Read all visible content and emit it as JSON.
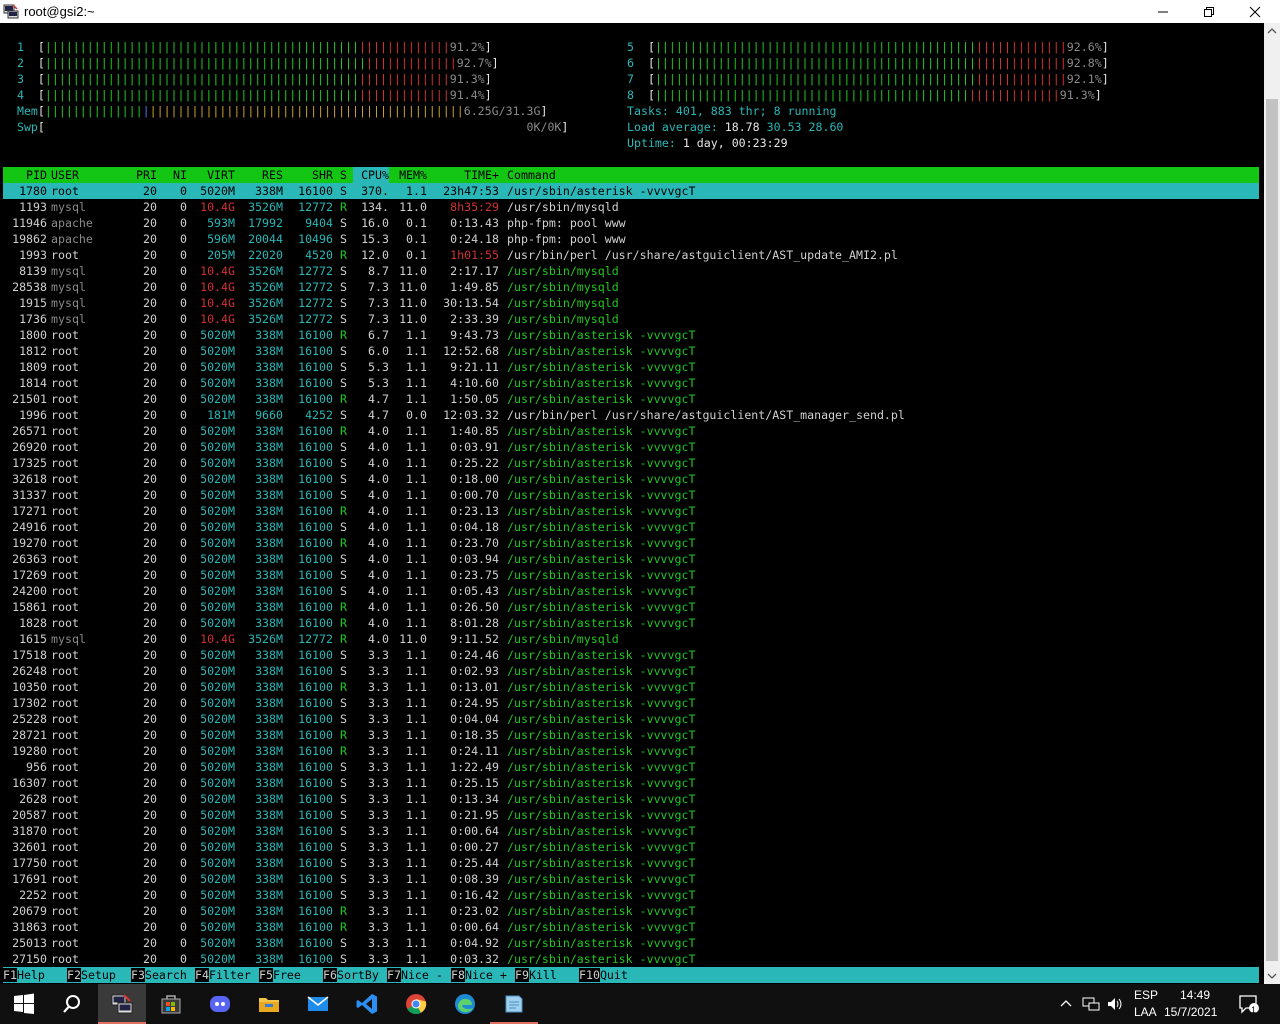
{
  "window": {
    "title": "root@gsi2:~"
  },
  "meters": {
    "cpus": [
      {
        "id": "1",
        "pct": "91.2%"
      },
      {
        "id": "2",
        "pct": "92.7%"
      },
      {
        "id": "3",
        "pct": "91.3%"
      },
      {
        "id": "4",
        "pct": "91.4%"
      },
      {
        "id": "5",
        "pct": "92.6%"
      },
      {
        "id": "6",
        "pct": "92.8%"
      },
      {
        "id": "7",
        "pct": "92.1%"
      },
      {
        "id": "8",
        "pct": "91.3%"
      }
    ],
    "mem": {
      "label": "Mem",
      "value": "6.25G/31.3G"
    },
    "swp": {
      "label": "Swp",
      "value": "0K/0K"
    },
    "tasks": {
      "label": "Tasks:",
      "count": "401,",
      "thr": "883",
      "thr_label": "thr;",
      "running": "8",
      "running_label": "running"
    },
    "load": {
      "label": "Load average:",
      "l1": "18.78",
      "l5": "30.53",
      "l15": "28.60"
    },
    "uptime": {
      "label": "Uptime:",
      "value": "1 day, 00:23:29"
    }
  },
  "columns": {
    "pid": "PID",
    "user": "USER",
    "pri": "PRI",
    "ni": "NI",
    "virt": "VIRT",
    "res": "RES",
    "shr": "SHR",
    "s": "S",
    "cpu": "CPU%",
    "mem": "MEM%",
    "time": "TIME+",
    "cmd": "Command"
  },
  "processes": [
    {
      "pid": "1780",
      "user": "root",
      "pri": "20",
      "ni": "0",
      "virt": "5020M",
      "res": "338M",
      "shr": "16100",
      "s": "S",
      "cpu": "370.",
      "mem": "1.1",
      "time": "23h47:53",
      "cmd": "/usr/sbin/asterisk -vvvvgcT"
    },
    {
      "pid": "1193",
      "user": "mysql",
      "pri": "20",
      "ni": "0",
      "virt": "10.4G",
      "res": "3526M",
      "shr": "12772",
      "s": "R",
      "cpu": "134.",
      "mem": "11.0",
      "time": "8h35:29",
      "cmd": "/usr/sbin/mysqld"
    },
    {
      "pid": "11946",
      "user": "apache",
      "pri": "20",
      "ni": "0",
      "virt": "593M",
      "res": "17992",
      "shr": "9404",
      "s": "S",
      "cpu": "16.0",
      "mem": "0.1",
      "time": "0:13.43",
      "cmd": "php-fpm: pool www"
    },
    {
      "pid": "19862",
      "user": "apache",
      "pri": "20",
      "ni": "0",
      "virt": "596M",
      "res": "20044",
      "shr": "10496",
      "s": "S",
      "cpu": "15.3",
      "mem": "0.1",
      "time": "0:24.18",
      "cmd": "php-fpm: pool www"
    },
    {
      "pid": "1993",
      "user": "root",
      "pri": "20",
      "ni": "0",
      "virt": "205M",
      "res": "22020",
      "shr": "4520",
      "s": "R",
      "cpu": "12.0",
      "mem": "0.1",
      "time": "1h01:55",
      "cmd": "/usr/bin/perl /usr/share/astguiclient/AST_update_AMI2.pl"
    },
    {
      "pid": "8139",
      "user": "mysql",
      "pri": "20",
      "ni": "0",
      "virt": "10.4G",
      "res": "3526M",
      "shr": "12772",
      "s": "S",
      "cpu": "8.7",
      "mem": "11.0",
      "time": "2:17.17",
      "cmd": "/usr/sbin/mysqld"
    },
    {
      "pid": "28538",
      "user": "mysql",
      "pri": "20",
      "ni": "0",
      "virt": "10.4G",
      "res": "3526M",
      "shr": "12772",
      "s": "S",
      "cpu": "7.3",
      "mem": "11.0",
      "time": "1:49.85",
      "cmd": "/usr/sbin/mysqld"
    },
    {
      "pid": "1915",
      "user": "mysql",
      "pri": "20",
      "ni": "0",
      "virt": "10.4G",
      "res": "3526M",
      "shr": "12772",
      "s": "S",
      "cpu": "7.3",
      "mem": "11.0",
      "time": "30:13.54",
      "cmd": "/usr/sbin/mysqld"
    },
    {
      "pid": "1736",
      "user": "mysql",
      "pri": "20",
      "ni": "0",
      "virt": "10.4G",
      "res": "3526M",
      "shr": "12772",
      "s": "S",
      "cpu": "7.3",
      "mem": "11.0",
      "time": "2:33.39",
      "cmd": "/usr/sbin/mysqld"
    },
    {
      "pid": "1800",
      "user": "root",
      "pri": "20",
      "ni": "0",
      "virt": "5020M",
      "res": "338M",
      "shr": "16100",
      "s": "R",
      "cpu": "6.7",
      "mem": "1.1",
      "time": "9:43.73",
      "cmd": "/usr/sbin/asterisk -vvvvgcT"
    },
    {
      "pid": "1812",
      "user": "root",
      "pri": "20",
      "ni": "0",
      "virt": "5020M",
      "res": "338M",
      "shr": "16100",
      "s": "S",
      "cpu": "6.0",
      "mem": "1.1",
      "time": "12:52.68",
      "cmd": "/usr/sbin/asterisk -vvvvgcT"
    },
    {
      "pid": "1809",
      "user": "root",
      "pri": "20",
      "ni": "0",
      "virt": "5020M",
      "res": "338M",
      "shr": "16100",
      "s": "S",
      "cpu": "5.3",
      "mem": "1.1",
      "time": "9:21.11",
      "cmd": "/usr/sbin/asterisk -vvvvgcT"
    },
    {
      "pid": "1814",
      "user": "root",
      "pri": "20",
      "ni": "0",
      "virt": "5020M",
      "res": "338M",
      "shr": "16100",
      "s": "S",
      "cpu": "5.3",
      "mem": "1.1",
      "time": "4:10.60",
      "cmd": "/usr/sbin/asterisk -vvvvgcT"
    },
    {
      "pid": "21501",
      "user": "root",
      "pri": "20",
      "ni": "0",
      "virt": "5020M",
      "res": "338M",
      "shr": "16100",
      "s": "R",
      "cpu": "4.7",
      "mem": "1.1",
      "time": "1:50.05",
      "cmd": "/usr/sbin/asterisk -vvvvgcT"
    },
    {
      "pid": "1996",
      "user": "root",
      "pri": "20",
      "ni": "0",
      "virt": "181M",
      "res": "9660",
      "shr": "4252",
      "s": "S",
      "cpu": "4.7",
      "mem": "0.0",
      "time": "12:03.32",
      "cmd": "/usr/bin/perl /usr/share/astguiclient/AST_manager_send.pl"
    },
    {
      "pid": "26571",
      "user": "root",
      "pri": "20",
      "ni": "0",
      "virt": "5020M",
      "res": "338M",
      "shr": "16100",
      "s": "R",
      "cpu": "4.0",
      "mem": "1.1",
      "time": "1:40.85",
      "cmd": "/usr/sbin/asterisk -vvvvgcT"
    },
    {
      "pid": "26920",
      "user": "root",
      "pri": "20",
      "ni": "0",
      "virt": "5020M",
      "res": "338M",
      "shr": "16100",
      "s": "S",
      "cpu": "4.0",
      "mem": "1.1",
      "time": "0:03.91",
      "cmd": "/usr/sbin/asterisk -vvvvgcT"
    },
    {
      "pid": "17325",
      "user": "root",
      "pri": "20",
      "ni": "0",
      "virt": "5020M",
      "res": "338M",
      "shr": "16100",
      "s": "S",
      "cpu": "4.0",
      "mem": "1.1",
      "time": "0:25.22",
      "cmd": "/usr/sbin/asterisk -vvvvgcT"
    },
    {
      "pid": "32618",
      "user": "root",
      "pri": "20",
      "ni": "0",
      "virt": "5020M",
      "res": "338M",
      "shr": "16100",
      "s": "S",
      "cpu": "4.0",
      "mem": "1.1",
      "time": "0:18.00",
      "cmd": "/usr/sbin/asterisk -vvvvgcT"
    },
    {
      "pid": "31337",
      "user": "root",
      "pri": "20",
      "ni": "0",
      "virt": "5020M",
      "res": "338M",
      "shr": "16100",
      "s": "S",
      "cpu": "4.0",
      "mem": "1.1",
      "time": "0:00.70",
      "cmd": "/usr/sbin/asterisk -vvvvgcT"
    },
    {
      "pid": "17271",
      "user": "root",
      "pri": "20",
      "ni": "0",
      "virt": "5020M",
      "res": "338M",
      "shr": "16100",
      "s": "R",
      "cpu": "4.0",
      "mem": "1.1",
      "time": "0:23.13",
      "cmd": "/usr/sbin/asterisk -vvvvgcT"
    },
    {
      "pid": "24916",
      "user": "root",
      "pri": "20",
      "ni": "0",
      "virt": "5020M",
      "res": "338M",
      "shr": "16100",
      "s": "S",
      "cpu": "4.0",
      "mem": "1.1",
      "time": "0:04.18",
      "cmd": "/usr/sbin/asterisk -vvvvgcT"
    },
    {
      "pid": "19270",
      "user": "root",
      "pri": "20",
      "ni": "0",
      "virt": "5020M",
      "res": "338M",
      "shr": "16100",
      "s": "R",
      "cpu": "4.0",
      "mem": "1.1",
      "time": "0:23.70",
      "cmd": "/usr/sbin/asterisk -vvvvgcT"
    },
    {
      "pid": "26363",
      "user": "root",
      "pri": "20",
      "ni": "0",
      "virt": "5020M",
      "res": "338M",
      "shr": "16100",
      "s": "S",
      "cpu": "4.0",
      "mem": "1.1",
      "time": "0:03.94",
      "cmd": "/usr/sbin/asterisk -vvvvgcT"
    },
    {
      "pid": "17269",
      "user": "root",
      "pri": "20",
      "ni": "0",
      "virt": "5020M",
      "res": "338M",
      "shr": "16100",
      "s": "S",
      "cpu": "4.0",
      "mem": "1.1",
      "time": "0:23.75",
      "cmd": "/usr/sbin/asterisk -vvvvgcT"
    },
    {
      "pid": "24200",
      "user": "root",
      "pri": "20",
      "ni": "0",
      "virt": "5020M",
      "res": "338M",
      "shr": "16100",
      "s": "S",
      "cpu": "4.0",
      "mem": "1.1",
      "time": "0:05.43",
      "cmd": "/usr/sbin/asterisk -vvvvgcT"
    },
    {
      "pid": "15861",
      "user": "root",
      "pri": "20",
      "ni": "0",
      "virt": "5020M",
      "res": "338M",
      "shr": "16100",
      "s": "R",
      "cpu": "4.0",
      "mem": "1.1",
      "time": "0:26.50",
      "cmd": "/usr/sbin/asterisk -vvvvgcT"
    },
    {
      "pid": "1828",
      "user": "root",
      "pri": "20",
      "ni": "0",
      "virt": "5020M",
      "res": "338M",
      "shr": "16100",
      "s": "R",
      "cpu": "4.0",
      "mem": "1.1",
      "time": "8:01.28",
      "cmd": "/usr/sbin/asterisk -vvvvgcT"
    },
    {
      "pid": "1615",
      "user": "mysql",
      "pri": "20",
      "ni": "0",
      "virt": "10.4G",
      "res": "3526M",
      "shr": "12772",
      "s": "R",
      "cpu": "4.0",
      "mem": "11.0",
      "time": "9:11.52",
      "cmd": "/usr/sbin/mysqld"
    },
    {
      "pid": "17518",
      "user": "root",
      "pri": "20",
      "ni": "0",
      "virt": "5020M",
      "res": "338M",
      "shr": "16100",
      "s": "S",
      "cpu": "3.3",
      "mem": "1.1",
      "time": "0:24.46",
      "cmd": "/usr/sbin/asterisk -vvvvgcT"
    },
    {
      "pid": "26248",
      "user": "root",
      "pri": "20",
      "ni": "0",
      "virt": "5020M",
      "res": "338M",
      "shr": "16100",
      "s": "S",
      "cpu": "3.3",
      "mem": "1.1",
      "time": "0:02.93",
      "cmd": "/usr/sbin/asterisk -vvvvgcT"
    },
    {
      "pid": "10350",
      "user": "root",
      "pri": "20",
      "ni": "0",
      "virt": "5020M",
      "res": "338M",
      "shr": "16100",
      "s": "R",
      "cpu": "3.3",
      "mem": "1.1",
      "time": "0:13.01",
      "cmd": "/usr/sbin/asterisk -vvvvgcT"
    },
    {
      "pid": "17302",
      "user": "root",
      "pri": "20",
      "ni": "0",
      "virt": "5020M",
      "res": "338M",
      "shr": "16100",
      "s": "S",
      "cpu": "3.3",
      "mem": "1.1",
      "time": "0:24.95",
      "cmd": "/usr/sbin/asterisk -vvvvgcT"
    },
    {
      "pid": "25228",
      "user": "root",
      "pri": "20",
      "ni": "0",
      "virt": "5020M",
      "res": "338M",
      "shr": "16100",
      "s": "S",
      "cpu": "3.3",
      "mem": "1.1",
      "time": "0:04.04",
      "cmd": "/usr/sbin/asterisk -vvvvgcT"
    },
    {
      "pid": "28721",
      "user": "root",
      "pri": "20",
      "ni": "0",
      "virt": "5020M",
      "res": "338M",
      "shr": "16100",
      "s": "R",
      "cpu": "3.3",
      "mem": "1.1",
      "time": "0:18.35",
      "cmd": "/usr/sbin/asterisk -vvvvgcT"
    },
    {
      "pid": "19280",
      "user": "root",
      "pri": "20",
      "ni": "0",
      "virt": "5020M",
      "res": "338M",
      "shr": "16100",
      "s": "R",
      "cpu": "3.3",
      "mem": "1.1",
      "time": "0:24.11",
      "cmd": "/usr/sbin/asterisk -vvvvgcT"
    },
    {
      "pid": "956",
      "user": "root",
      "pri": "20",
      "ni": "0",
      "virt": "5020M",
      "res": "338M",
      "shr": "16100",
      "s": "S",
      "cpu": "3.3",
      "mem": "1.1",
      "time": "1:22.49",
      "cmd": "/usr/sbin/asterisk -vvvvgcT"
    },
    {
      "pid": "16307",
      "user": "root",
      "pri": "20",
      "ni": "0",
      "virt": "5020M",
      "res": "338M",
      "shr": "16100",
      "s": "S",
      "cpu": "3.3",
      "mem": "1.1",
      "time": "0:25.15",
      "cmd": "/usr/sbin/asterisk -vvvvgcT"
    },
    {
      "pid": "2628",
      "user": "root",
      "pri": "20",
      "ni": "0",
      "virt": "5020M",
      "res": "338M",
      "shr": "16100",
      "s": "S",
      "cpu": "3.3",
      "mem": "1.1",
      "time": "0:13.34",
      "cmd": "/usr/sbin/asterisk -vvvvgcT"
    },
    {
      "pid": "20587",
      "user": "root",
      "pri": "20",
      "ni": "0",
      "virt": "5020M",
      "res": "338M",
      "shr": "16100",
      "s": "S",
      "cpu": "3.3",
      "mem": "1.1",
      "time": "0:21.95",
      "cmd": "/usr/sbin/asterisk -vvvvgcT"
    },
    {
      "pid": "31870",
      "user": "root",
      "pri": "20",
      "ni": "0",
      "virt": "5020M",
      "res": "338M",
      "shr": "16100",
      "s": "S",
      "cpu": "3.3",
      "mem": "1.1",
      "time": "0:00.64",
      "cmd": "/usr/sbin/asterisk -vvvvgcT"
    },
    {
      "pid": "32601",
      "user": "root",
      "pri": "20",
      "ni": "0",
      "virt": "5020M",
      "res": "338M",
      "shr": "16100",
      "s": "S",
      "cpu": "3.3",
      "mem": "1.1",
      "time": "0:00.27",
      "cmd": "/usr/sbin/asterisk -vvvvgcT"
    },
    {
      "pid": "17750",
      "user": "root",
      "pri": "20",
      "ni": "0",
      "virt": "5020M",
      "res": "338M",
      "shr": "16100",
      "s": "S",
      "cpu": "3.3",
      "mem": "1.1",
      "time": "0:25.44",
      "cmd": "/usr/sbin/asterisk -vvvvgcT"
    },
    {
      "pid": "17691",
      "user": "root",
      "pri": "20",
      "ni": "0",
      "virt": "5020M",
      "res": "338M",
      "shr": "16100",
      "s": "S",
      "cpu": "3.3",
      "mem": "1.1",
      "time": "0:08.39",
      "cmd": "/usr/sbin/asterisk -vvvvgcT"
    },
    {
      "pid": "2252",
      "user": "root",
      "pri": "20",
      "ni": "0",
      "virt": "5020M",
      "res": "338M",
      "shr": "16100",
      "s": "S",
      "cpu": "3.3",
      "mem": "1.1",
      "time": "0:16.42",
      "cmd": "/usr/sbin/asterisk -vvvvgcT"
    },
    {
      "pid": "20679",
      "user": "root",
      "pri": "20",
      "ni": "0",
      "virt": "5020M",
      "res": "338M",
      "shr": "16100",
      "s": "R",
      "cpu": "3.3",
      "mem": "1.1",
      "time": "0:23.02",
      "cmd": "/usr/sbin/asterisk -vvvvgcT"
    },
    {
      "pid": "31863",
      "user": "root",
      "pri": "20",
      "ni": "0",
      "virt": "5020M",
      "res": "338M",
      "shr": "16100",
      "s": "R",
      "cpu": "3.3",
      "mem": "1.1",
      "time": "0:00.64",
      "cmd": "/usr/sbin/asterisk -vvvvgcT"
    },
    {
      "pid": "25013",
      "user": "root",
      "pri": "20",
      "ni": "0",
      "virt": "5020M",
      "res": "338M",
      "shr": "16100",
      "s": "S",
      "cpu": "3.3",
      "mem": "1.1",
      "time": "0:04.92",
      "cmd": "/usr/sbin/asterisk -vvvvgcT"
    },
    {
      "pid": "27150",
      "user": "root",
      "pri": "20",
      "ni": "0",
      "virt": "5020M",
      "res": "338M",
      "shr": "16100",
      "s": "S",
      "cpu": "3.3",
      "mem": "1.1",
      "time": "0:03.32",
      "cmd": "/usr/sbin/asterisk -vvvvgcT"
    }
  ],
  "fkeys": [
    {
      "key": "F1",
      "label": "Help  "
    },
    {
      "key": "F2",
      "label": "Setup "
    },
    {
      "key": "F3",
      "label": "Search"
    },
    {
      "key": "F4",
      "label": "Filter"
    },
    {
      "key": "F5",
      "label": "Free  "
    },
    {
      "key": "F6",
      "label": "SortBy"
    },
    {
      "key": "F7",
      "label": "Nice -"
    },
    {
      "key": "F8",
      "label": "Nice +"
    },
    {
      "key": "F9",
      "label": "Kill  "
    },
    {
      "key": "F10",
      "label": "Quit  "
    }
  ],
  "taskbar": {
    "lang_top": "ESP",
    "lang_bottom": "LAA",
    "time": "14:49",
    "date": "15/7/2021",
    "notifications": "1",
    "icons": [
      "windows-start-icon",
      "search-icon",
      "putty-icon",
      "store-icon",
      "discord-icon",
      "file-explorer-icon",
      "mail-icon",
      "vscode-icon",
      "chrome-icon",
      "edge-icon",
      "notepad-icon"
    ]
  },
  "colors": {
    "green": "#23c623",
    "red": "#d23131",
    "cyan": "#2ab7b7",
    "header_bg": "#13c613"
  }
}
